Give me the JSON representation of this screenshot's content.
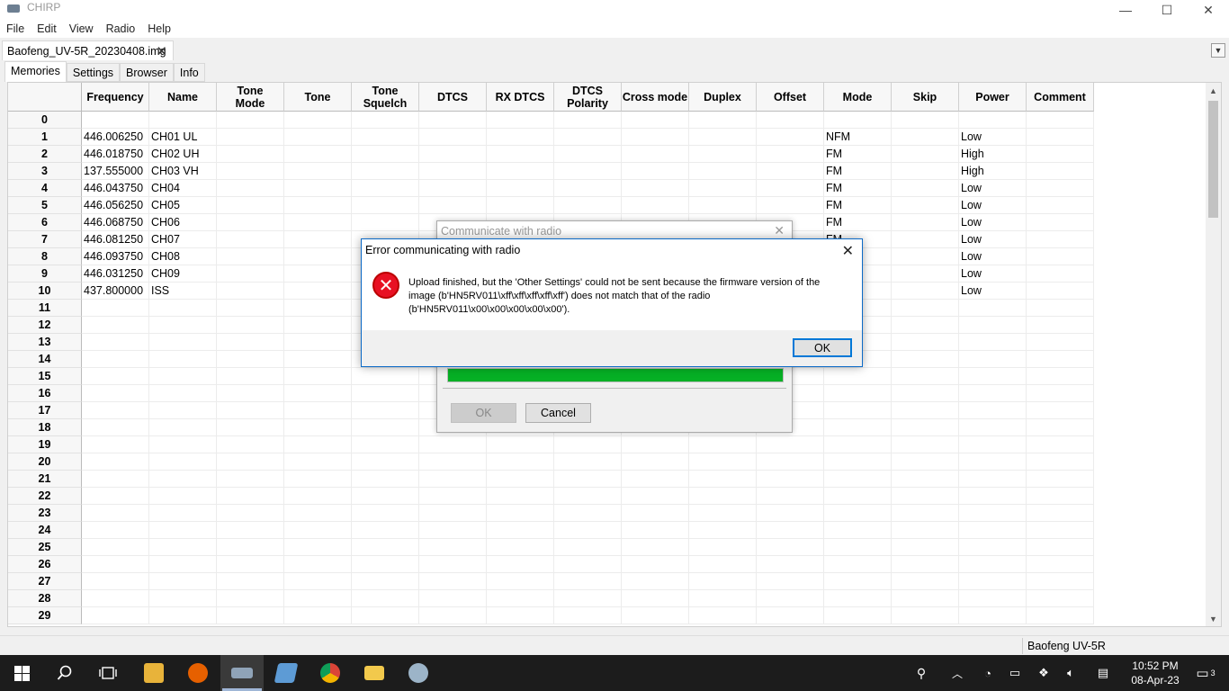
{
  "window": {
    "title": "CHIRP",
    "controls": {
      "minimize": "—",
      "maximize": "☐",
      "close": "✕"
    }
  },
  "menu": [
    "File",
    "Edit",
    "View",
    "Radio",
    "Help"
  ],
  "file_tab": {
    "label": "Baofeng_UV-5R_20230408.img",
    "close": "✕",
    "dropdown": "▼"
  },
  "tabs": [
    {
      "label": "Memories",
      "active": true
    },
    {
      "label": "Settings",
      "active": false
    },
    {
      "label": "Browser",
      "active": false
    },
    {
      "label": "Info",
      "active": false
    }
  ],
  "grid": {
    "columns": [
      "Frequency",
      "Name",
      "Tone Mode",
      "Tone",
      "Tone Squelch",
      "DTCS",
      "RX DTCS",
      "DTCS Polarity",
      "Cross mode",
      "Duplex",
      "Offset",
      "Mode",
      "Skip",
      "Power",
      "Comment"
    ],
    "column_lines": [
      [
        "Frequency"
      ],
      [
        "Name"
      ],
      [
        "Tone",
        "Mode"
      ],
      [
        "Tone"
      ],
      [
        "Tone",
        "Squelch"
      ],
      [
        "DTCS"
      ],
      [
        "RX DTCS"
      ],
      [
        "DTCS",
        "Polarity"
      ],
      [
        "Cross mode"
      ],
      [
        "Duplex"
      ],
      [
        "Offset"
      ],
      [
        "Mode"
      ],
      [
        "Skip"
      ],
      [
        "Power"
      ],
      [
        "Comment"
      ]
    ],
    "rows": [
      {
        "num": "0",
        "frequency": "",
        "name": "",
        "mode": "",
        "power": ""
      },
      {
        "num": "1",
        "frequency": "446.006250",
        "name": "CH01 UL",
        "mode": "NFM",
        "power": "Low"
      },
      {
        "num": "2",
        "frequency": "446.018750",
        "name": "CH02 UH",
        "mode": "FM",
        "power": "High"
      },
      {
        "num": "3",
        "frequency": "137.555000",
        "name": "CH03 VH",
        "mode": "FM",
        "power": "High"
      },
      {
        "num": "4",
        "frequency": "446.043750",
        "name": "CH04",
        "mode": "FM",
        "power": "Low"
      },
      {
        "num": "5",
        "frequency": "446.056250",
        "name": "CH05",
        "mode": "FM",
        "power": "Low"
      },
      {
        "num": "6",
        "frequency": "446.068750",
        "name": "CH06",
        "mode": "FM",
        "power": "Low"
      },
      {
        "num": "7",
        "frequency": "446.081250",
        "name": "CH07",
        "mode": "FM",
        "power": "Low"
      },
      {
        "num": "8",
        "frequency": "446.093750",
        "name": "CH08",
        "mode": "",
        "power": "Low"
      },
      {
        "num": "9",
        "frequency": "446.031250",
        "name": "CH09",
        "mode": "",
        "power": "Low"
      },
      {
        "num": "10",
        "frequency": "437.800000",
        "name": "ISS",
        "mode": "",
        "power": "Low"
      },
      {
        "num": "11",
        "frequency": "",
        "name": "",
        "mode": "",
        "power": ""
      },
      {
        "num": "12",
        "frequency": "",
        "name": "",
        "mode": "",
        "power": ""
      },
      {
        "num": "13",
        "frequency": "",
        "name": "",
        "mode": "",
        "power": ""
      },
      {
        "num": "14",
        "frequency": "",
        "name": "",
        "mode": "",
        "power": ""
      },
      {
        "num": "15",
        "frequency": "",
        "name": "",
        "mode": "",
        "power": ""
      },
      {
        "num": "16",
        "frequency": "",
        "name": "",
        "mode": "",
        "power": ""
      },
      {
        "num": "17",
        "frequency": "",
        "name": "",
        "mode": "",
        "power": ""
      },
      {
        "num": "18",
        "frequency": "",
        "name": "",
        "mode": "",
        "power": ""
      },
      {
        "num": "19",
        "frequency": "",
        "name": "",
        "mode": "",
        "power": ""
      },
      {
        "num": "20",
        "frequency": "",
        "name": "",
        "mode": "",
        "power": ""
      },
      {
        "num": "21",
        "frequency": "",
        "name": "",
        "mode": "",
        "power": ""
      },
      {
        "num": "22",
        "frequency": "",
        "name": "",
        "mode": "",
        "power": ""
      },
      {
        "num": "23",
        "frequency": "",
        "name": "",
        "mode": "",
        "power": ""
      },
      {
        "num": "24",
        "frequency": "",
        "name": "",
        "mode": "",
        "power": ""
      },
      {
        "num": "25",
        "frequency": "",
        "name": "",
        "mode": "",
        "power": ""
      },
      {
        "num": "26",
        "frequency": "",
        "name": "",
        "mode": "",
        "power": ""
      },
      {
        "num": "27",
        "frequency": "",
        "name": "",
        "mode": "",
        "power": ""
      },
      {
        "num": "28",
        "frequency": "",
        "name": "",
        "mode": "",
        "power": ""
      },
      {
        "num": "29",
        "frequency": "",
        "name": "",
        "mode": "",
        "power": ""
      }
    ]
  },
  "status_bar": {
    "model": "Baofeng UV-5R"
  },
  "comm_dialog": {
    "title": "Communicate with radio",
    "progress_percent": 100,
    "ok_label": "OK",
    "cancel_label": "Cancel",
    "progress_color": "#06b025"
  },
  "error_dialog": {
    "title": "Error communicating with radio",
    "message": "Upload finished, but the 'Other Settings' could not be sent because the firmware version of the image (b'HN5RV011\\xff\\xff\\xff\\xff\\xff') does not match that of the radio (b'HN5RV011\\x00\\x00\\x00\\x00\\x00').",
    "ok_label": "OK",
    "icon": "error-x-icon",
    "icon_color": "#e81123"
  },
  "taskbar": {
    "time": "10:52 PM",
    "date": "08-Apr-23",
    "notification_count": "3"
  }
}
